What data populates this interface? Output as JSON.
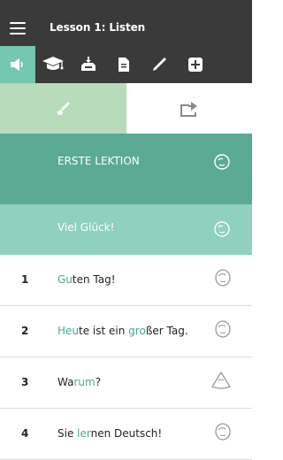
{
  "header": {
    "title": "Lesson 1: Listen"
  },
  "toolbar": {
    "tools": [
      {
        "icon": "speaker-icon",
        "active": true
      },
      {
        "icon": "graduation-cap-icon",
        "active": false
      },
      {
        "icon": "inbox-download-icon",
        "active": false
      },
      {
        "icon": "document-icon",
        "active": false
      },
      {
        "icon": "pencil-icon",
        "active": false
      },
      {
        "icon": "plus-box-icon",
        "active": false
      }
    ]
  },
  "modes": {
    "left_icon": "brush-icon",
    "right_icon": "repeat-icon"
  },
  "banners": [
    {
      "text": "ERSTE LEKTION",
      "color": "#5aaa94"
    },
    {
      "text": "Viel Glück!",
      "color": "#8fd0be"
    }
  ],
  "rows": [
    {
      "num": "1",
      "parts": [
        {
          "t": "Gu",
          "hl": true
        },
        {
          "t": "ten Tag!",
          "hl": false
        }
      ]
    },
    {
      "num": "2",
      "parts": [
        {
          "t": "Heu",
          "hl": true
        },
        {
          "t": "te ist ein ",
          "hl": false
        },
        {
          "t": "gro",
          "hl": true
        },
        {
          "t": "ßer Tag.",
          "hl": false
        }
      ]
    },
    {
      "num": "3",
      "parts": [
        {
          "t": "Wa",
          "hl": false
        },
        {
          "t": "rum",
          "hl": true
        },
        {
          "t": "?",
          "hl": false
        }
      ]
    },
    {
      "num": "4",
      "parts": [
        {
          "t": "Sie ",
          "hl": false
        },
        {
          "t": "ler",
          "hl": true
        },
        {
          "t": "nen Deutsch!",
          "hl": false
        }
      ]
    }
  ],
  "colors": {
    "bar": "#3a3a3a",
    "accent": "#74c7b0",
    "highlight": "#4aa88f"
  }
}
